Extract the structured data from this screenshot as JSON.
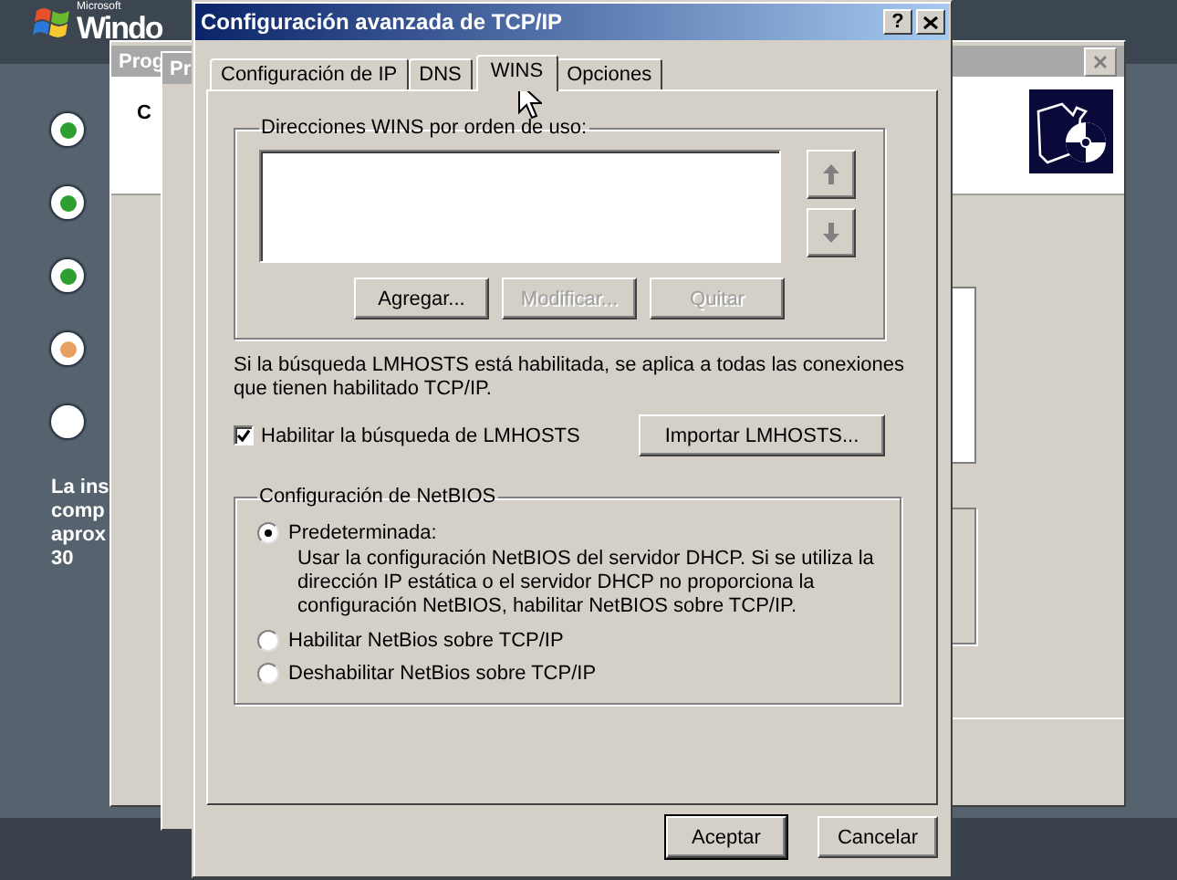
{
  "desktop": {
    "logo_small": "Microsoft",
    "logo": "Windo",
    "steps": [
      {
        "color": "#2e9e2e"
      },
      {
        "color": "#2e9e2e"
      },
      {
        "color": "#2e9e2e"
      },
      {
        "color": "#e8a060"
      },
      {
        "color": "#ffffff"
      }
    ],
    "note_lines": [
      "La ins",
      "comp",
      "aprox",
      "30"
    ]
  },
  "background_windows": [
    {
      "title": "Prog",
      "label": "C"
    },
    {
      "title": "Pr"
    }
  ],
  "dialog": {
    "title": "Configuración avanzada de TCP/IP",
    "help_button": "?",
    "tabs": [
      {
        "label": "Configuración de IP",
        "selected": false
      },
      {
        "label": "DNS",
        "selected": false
      },
      {
        "label": "WINS",
        "selected": true
      },
      {
        "label": "Opciones",
        "selected": false
      }
    ],
    "wins_group": {
      "title": "Direcciones WINS por orden de uso:",
      "buttons": [
        {
          "label": "Agregar...",
          "disabled": false
        },
        {
          "label": "Modificar...",
          "disabled": true
        },
        {
          "label": "Quitar",
          "disabled": true
        }
      ]
    },
    "lmhosts_text": "Si la búsqueda LMHOSTS está habilitada, se aplica a todas las conexiones que tienen habilitado TCP/IP.",
    "lmhosts_checkbox": {
      "label": "Habilitar la búsqueda de LMHOSTS",
      "checked": true
    },
    "import_button": "Importar LMHOSTS...",
    "netbios_group": {
      "title": "Configuración de NetBIOS",
      "options": [
        {
          "label": "Predeterminada:",
          "selected": true,
          "description": "Usar la configuración NetBIOS del servidor DHCP. Si se utiliza la dirección IP estática o el servidor DHCP no proporciona la configuración NetBIOS, habilitar NetBIOS sobre TCP/IP."
        },
        {
          "label": "Habilitar NetBios sobre TCP/IP",
          "selected": false
        },
        {
          "label": "Deshabilitar NetBios sobre TCP/IP",
          "selected": false
        }
      ]
    },
    "buttons": [
      {
        "label": "Aceptar",
        "default": true
      },
      {
        "label": "Cancelar",
        "default": false
      }
    ]
  }
}
